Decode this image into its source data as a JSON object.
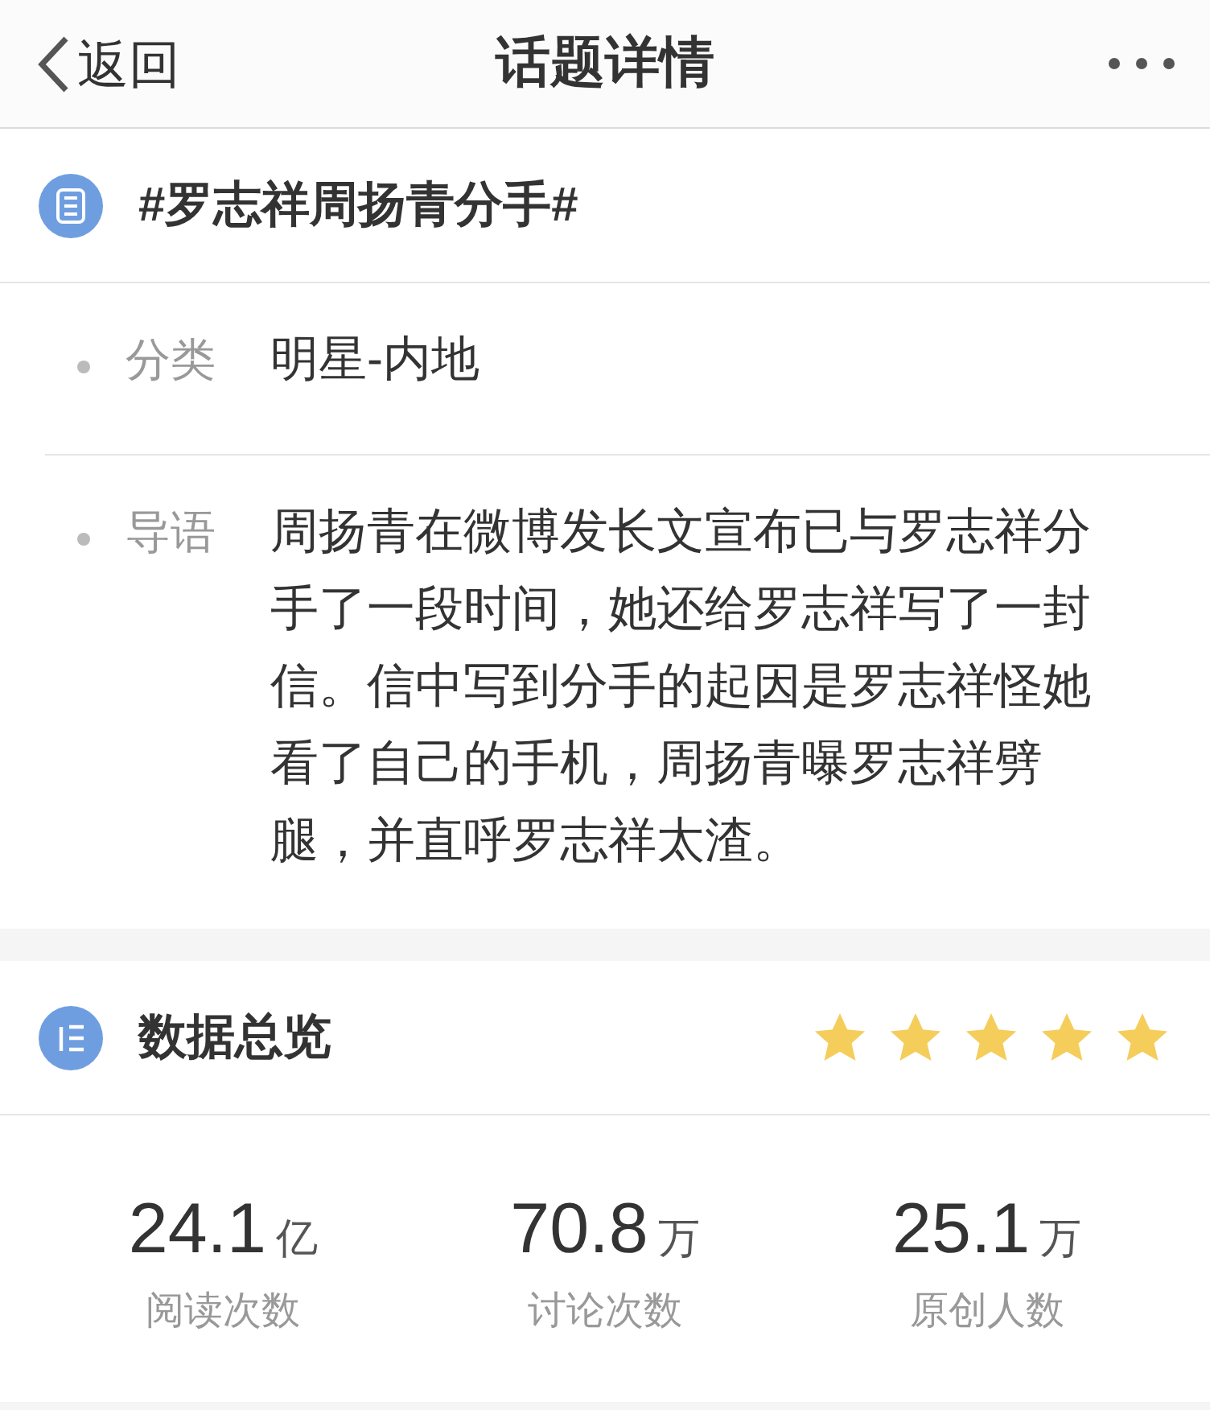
{
  "nav": {
    "back": "返回",
    "title": "话题详情"
  },
  "topic": {
    "title": "#罗志祥周扬青分手#"
  },
  "details": [
    {
      "label": "分类",
      "value": "明星-内地"
    },
    {
      "label": "导语",
      "value": "周扬青在微博发长文宣布已与罗志祥分手了一段时间，她还给罗志祥写了一封信。信中写到分手的起因是罗志祥怪她看了自己的手机，周扬青曝罗志祥劈腿，并直呼罗志祥太渣。"
    }
  ],
  "overview": {
    "title": "数据总览",
    "stars": 5,
    "stats": [
      {
        "number": "24.1",
        "unit": "亿",
        "label": "阅读次数"
      },
      {
        "number": "70.8",
        "unit": "万",
        "label": "讨论次数"
      },
      {
        "number": "25.1",
        "unit": "万",
        "label": "原创人数"
      }
    ]
  }
}
